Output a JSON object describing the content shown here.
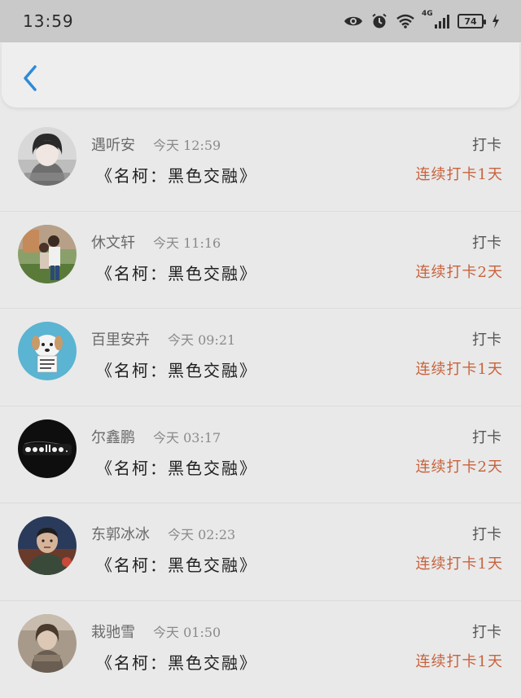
{
  "status": {
    "time": "13:59",
    "network": "4G",
    "battery": "74"
  },
  "colors": {
    "accent": "#2e8bd6",
    "streak": "#c8623c"
  },
  "records": [
    {
      "name": "遇听安",
      "time": "今天 12:59",
      "book": "《名柯：黑色交融》",
      "checkin": "打卡",
      "streak": "连续打卡1天"
    },
    {
      "name": "休文轩",
      "time": "今天 11:16",
      "book": "《名柯：黑色交融》",
      "checkin": "打卡",
      "streak": "连续打卡2天"
    },
    {
      "name": "百里安卉",
      "time": "今天 09:21",
      "book": "《名柯：黑色交融》",
      "checkin": "打卡",
      "streak": "连续打卡1天"
    },
    {
      "name": "尔鑫鹏",
      "time": "今天 03:17",
      "book": "《名柯：黑色交融》",
      "checkin": "打卡",
      "streak": "连续打卡2天"
    },
    {
      "name": "东郭冰冰",
      "time": "今天 02:23",
      "book": "《名柯：黑色交融》",
      "checkin": "打卡",
      "streak": "连续打卡1天"
    },
    {
      "name": "栽驰雪",
      "time": "今天 01:50",
      "book": "《名柯：黑色交融》",
      "checkin": "打卡",
      "streak": "连续打卡1天"
    }
  ]
}
